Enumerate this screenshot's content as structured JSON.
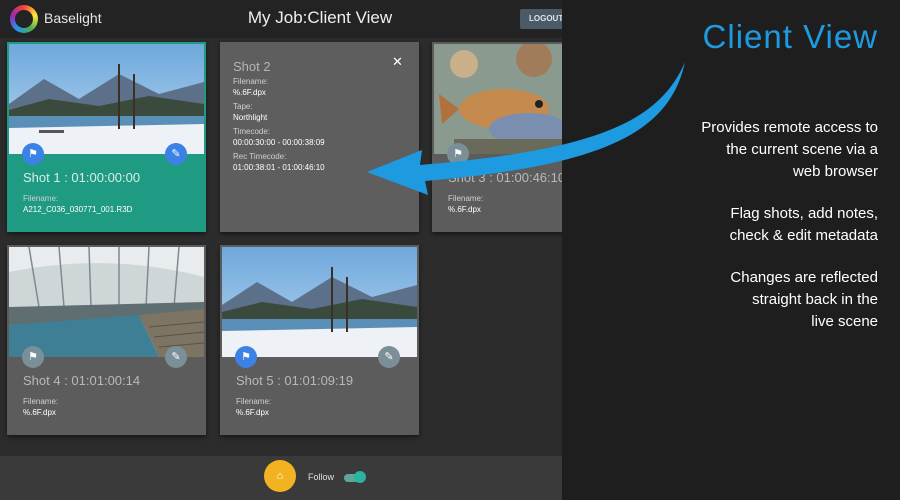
{
  "header": {
    "brand": "Baselight",
    "title": "My Job:Client View",
    "logout_label": "LOGOUT"
  },
  "shots": [
    {
      "title": "Shot 1 : 01:00:00:00",
      "filename_label": "Filename:",
      "filename": "A212_C036_030771_001.R3D",
      "flagged": true,
      "selected": true
    },
    {
      "title": "Shot 3 : 01:00:46:10",
      "filename_label": "Filename:",
      "filename": "%.6F.dpx",
      "flagged": false,
      "selected": false
    },
    {
      "title": "Shot 4 : 01:01:00:14",
      "filename_label": "Filename:",
      "filename": "%.6F.dpx",
      "flagged": false,
      "selected": false
    },
    {
      "title": "Shot 5 : 01:01:09:19",
      "filename_label": "Filename:",
      "filename": "%.6F.dpx",
      "flagged": true,
      "selected": false
    }
  ],
  "detail": {
    "title": "Shot 2",
    "close_icon": "close-icon",
    "fields": [
      {
        "label": "Filename:",
        "value": "%.6F.dpx"
      },
      {
        "label": "Tape:",
        "value": "Northlight"
      },
      {
        "label": "Timecode:",
        "value": "00:00:30:00 - 00:00:38:09"
      },
      {
        "label": "Rec Timecode:",
        "value": "01:00:38:01 - 01:00:46:10"
      }
    ]
  },
  "footer": {
    "follow_label": "Follow",
    "follow_on": true,
    "home_icon": "home-icon"
  },
  "panel": {
    "title": "Client View",
    "paragraph1": "Provides remote access to\nthe current scene via a\nweb browser",
    "paragraph2": "Flag shots, add notes,\ncheck & edit metadata",
    "paragraph3": "Changes are reflected\nstraight back in the\nlive scene"
  },
  "colors": {
    "accent": "#1e9ae0",
    "selected_card": "#1f9a83",
    "flag_active": "#3c82e6",
    "home_button": "#f3b21f"
  }
}
